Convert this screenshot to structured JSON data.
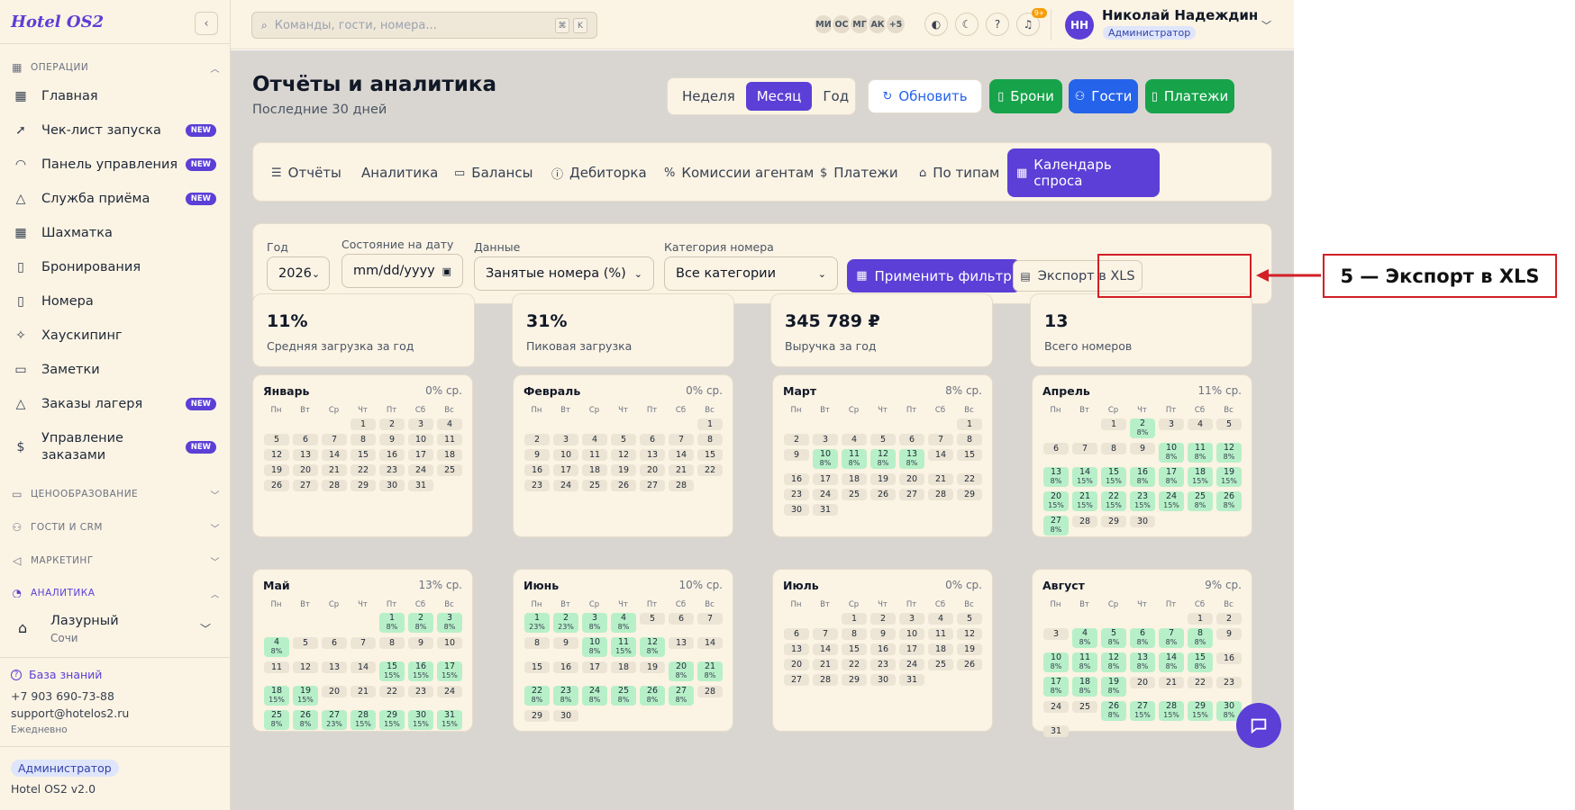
{
  "sidebar": {
    "logo": "Hotel OS2",
    "sections": {
      "ops": "ОПЕРАЦИИ",
      "pricing": "ЦЕНООБРАЗОВАНИЕ",
      "crm": "ГОСТИ И CRM",
      "marketing": "МАРКЕТИНГ",
      "analytics": "АНАЛИТИКА"
    },
    "items": [
      {
        "label": "Главная",
        "icon": "grid-icon",
        "new": false
      },
      {
        "label": "Чек-лист запуска",
        "icon": "rocket-icon",
        "new": true
      },
      {
        "label": "Панель управления",
        "icon": "gauge-icon",
        "new": true
      },
      {
        "label": "Служба приёма",
        "icon": "bell-icon",
        "new": true
      },
      {
        "label": "Шахматка",
        "icon": "table-icon",
        "new": false
      },
      {
        "label": "Бронирования",
        "icon": "clipboard-icon",
        "new": false
      },
      {
        "label": "Номера",
        "icon": "door-icon",
        "new": false
      },
      {
        "label": "Хаускипинг",
        "icon": "sparkles-icon",
        "new": false
      },
      {
        "label": "Заметки",
        "icon": "note-icon",
        "new": false
      },
      {
        "label": "Заказы лагеря",
        "icon": "tent-icon",
        "new": true
      },
      {
        "label": "Управление заказами",
        "icon": "receipt-icon",
        "new": true
      }
    ],
    "new_label": "NEW",
    "hotel": {
      "name": "Лазурный",
      "city": "Сочи"
    },
    "knowledge": "База знаний",
    "phone": "+7 903 690-73-88",
    "email": "support@hotelos2.ru",
    "schedule": "Ежедневно",
    "role": "Администратор",
    "version": "Hotel OS2 v2.0"
  },
  "header": {
    "search_placeholder": "Команды, гости, номера...",
    "kbd1": "⌘",
    "kbd2": "K",
    "avatars": [
      "МИ",
      "ОС",
      "МГ",
      "АК",
      "+5"
    ],
    "notif_count": "9+",
    "user_initials": "НН",
    "user_name": "Николай Надеждин",
    "user_role": "Администратор"
  },
  "page": {
    "title": "Отчёты и аналитика",
    "subtitle": "Последние 30 дней",
    "periods": [
      "Неделя",
      "Месяц",
      "Год"
    ],
    "refresh": "Обновить",
    "btn_bookings": "Брони",
    "btn_guests": "Гости",
    "btn_payments": "Платежи",
    "colors": {
      "accent": "#5b3fd6",
      "green": "#16a34a",
      "blue": "#2563eb"
    }
  },
  "tabs": [
    "Отчёты",
    "Аналитика",
    "Балансы",
    "Дебиторка",
    "Комиссии агентам",
    "Платежи",
    "По типам",
    "Календарь спроса"
  ],
  "filters": {
    "year_label": "Год",
    "year_value": "2026",
    "date_label": "Состояние на дату",
    "date_value": "mm/dd/yyyy",
    "data_label": "Данные",
    "data_value": "Занятые номера (%)",
    "cat_label": "Категория номера",
    "cat_value": "Все категории",
    "apply": "Применить фильтр",
    "export": "Экспорт в XLS"
  },
  "stats": [
    {
      "value": "11%",
      "label": "Средняя загрузка за год"
    },
    {
      "value": "31%",
      "label": "Пиковая загрузка"
    },
    {
      "value": "345 789 ₽",
      "label": "Выручка за год"
    },
    {
      "value": "13",
      "label": "Всего номеров"
    }
  ],
  "weekdays": [
    "Пн",
    "Вт",
    "Ср",
    "Чт",
    "Пт",
    "Сб",
    "Вс"
  ],
  "months": [
    {
      "name": "Январь",
      "avg": "0% ср.",
      "start": 3,
      "days": 31,
      "occ": {}
    },
    {
      "name": "Февраль",
      "avg": "0% ср.",
      "start": 6,
      "days": 28,
      "occ": {}
    },
    {
      "name": "Март",
      "avg": "8% ср.",
      "start": 6,
      "days": 31,
      "occ": {
        "10": "8%",
        "11": "8%",
        "12": "8%",
        "13": "8%"
      }
    },
    {
      "name": "Апрель",
      "avg": "11% ср.",
      "start": 2,
      "days": 30,
      "occ": {
        "2": "8%",
        "10": "8%",
        "11": "8%",
        "12": "8%",
        "13": "8%",
        "14": "15%",
        "15": "15%",
        "16": "8%",
        "17": "8%",
        "18": "15%",
        "19": "15%",
        "20": "15%",
        "21": "15%",
        "22": "15%",
        "23": "15%",
        "24": "15%",
        "25": "8%",
        "26": "8%",
        "27": "8%"
      }
    },
    {
      "name": "Май",
      "avg": "13% ср.",
      "start": 4,
      "days": 31,
      "occ": {
        "1": "8%",
        "2": "8%",
        "3": "8%",
        "4": "8%",
        "15": "15%",
        "16": "15%",
        "17": "15%",
        "18": "15%",
        "19": "15%",
        "25": "8%",
        "26": "8%",
        "27": "23%",
        "28": "15%",
        "29": "15%",
        "30": "15%",
        "31": "15%"
      }
    },
    {
      "name": "Июнь",
      "avg": "10% ср.",
      "start": 0,
      "days": 30,
      "occ": {
        "1": "23%",
        "2": "23%",
        "3": "8%",
        "4": "8%",
        "10": "8%",
        "11": "15%",
        "12": "8%",
        "20": "8%",
        "21": "8%",
        "22": "8%",
        "23": "8%",
        "24": "8%",
        "25": "8%",
        "26": "8%",
        "27": "8%"
      }
    },
    {
      "name": "Июль",
      "avg": "0% ср.",
      "start": 2,
      "days": 31,
      "occ": {}
    },
    {
      "name": "Август",
      "avg": "9% ср.",
      "start": 5,
      "days": 31,
      "occ": {
        "4": "8%",
        "5": "8%",
        "6": "8%",
        "7": "8%",
        "8": "8%",
        "10": "8%",
        "11": "8%",
        "12": "8%",
        "13": "8%",
        "14": "8%",
        "15": "8%",
        "17": "8%",
        "18": "8%",
        "19": "8%",
        "26": "8%",
        "27": "15%",
        "28": "15%",
        "29": "15%",
        "30": "8%"
      }
    }
  ],
  "annotation": {
    "label": "5 — Экспорт в XLS"
  }
}
